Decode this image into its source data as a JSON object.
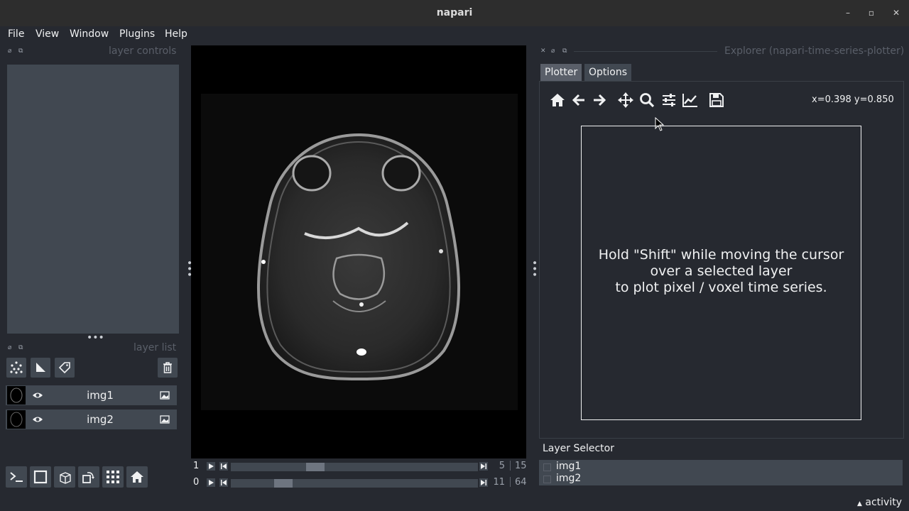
{
  "window": {
    "title": "napari"
  },
  "menu": {
    "file": "File",
    "view": "View",
    "window": "Window",
    "plugins": "Plugins",
    "help": "Help"
  },
  "left_dock": {
    "layer_controls_title": "layer controls",
    "layer_list_title": "layer list"
  },
  "layers": [
    {
      "name": "img1",
      "visible": true
    },
    {
      "name": "img2",
      "visible": true
    }
  ],
  "dims": [
    {
      "axis": "1",
      "current": "5",
      "total": "15",
      "fraction": 0.33
    },
    {
      "axis": "0",
      "current": "11",
      "total": "64",
      "fraction": 0.19
    }
  ],
  "plugin": {
    "title": "Explorer (napari-time-series-plotter)",
    "tabs": [
      "Plotter",
      "Options"
    ],
    "active_tab": "Plotter",
    "coords": "x=0.398 y=0.850",
    "plot_message_line1": "Hold \"Shift\" while moving the cursor",
    "plot_message_line2": "over a selected layer",
    "plot_message_line3": "to plot pixel / voxel time series.",
    "layer_selector_label": "Layer Selector",
    "layer_selector_items": [
      "img1",
      "img2"
    ]
  },
  "status": {
    "activity": "activity"
  },
  "colors": {
    "background": "#262930",
    "panel": "#414851",
    "accent": "#5a5f69",
    "text": "#f0f1f2"
  }
}
